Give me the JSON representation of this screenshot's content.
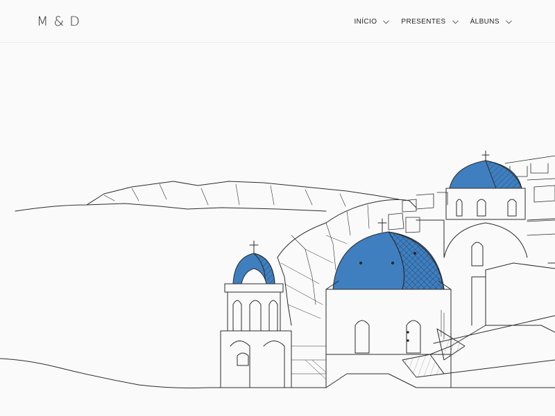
{
  "header": {
    "logo": "M & D"
  },
  "nav": [
    {
      "label": "INÍCIO"
    },
    {
      "label": "PRESENTES"
    },
    {
      "label": "ÁLBUNS"
    }
  ],
  "hero": {
    "illustration": "santorini-blue-domes-sketch"
  },
  "colors": {
    "dome_blue": "#3f7fbf",
    "line": "#2a2a2a",
    "background": "#fafafa"
  }
}
